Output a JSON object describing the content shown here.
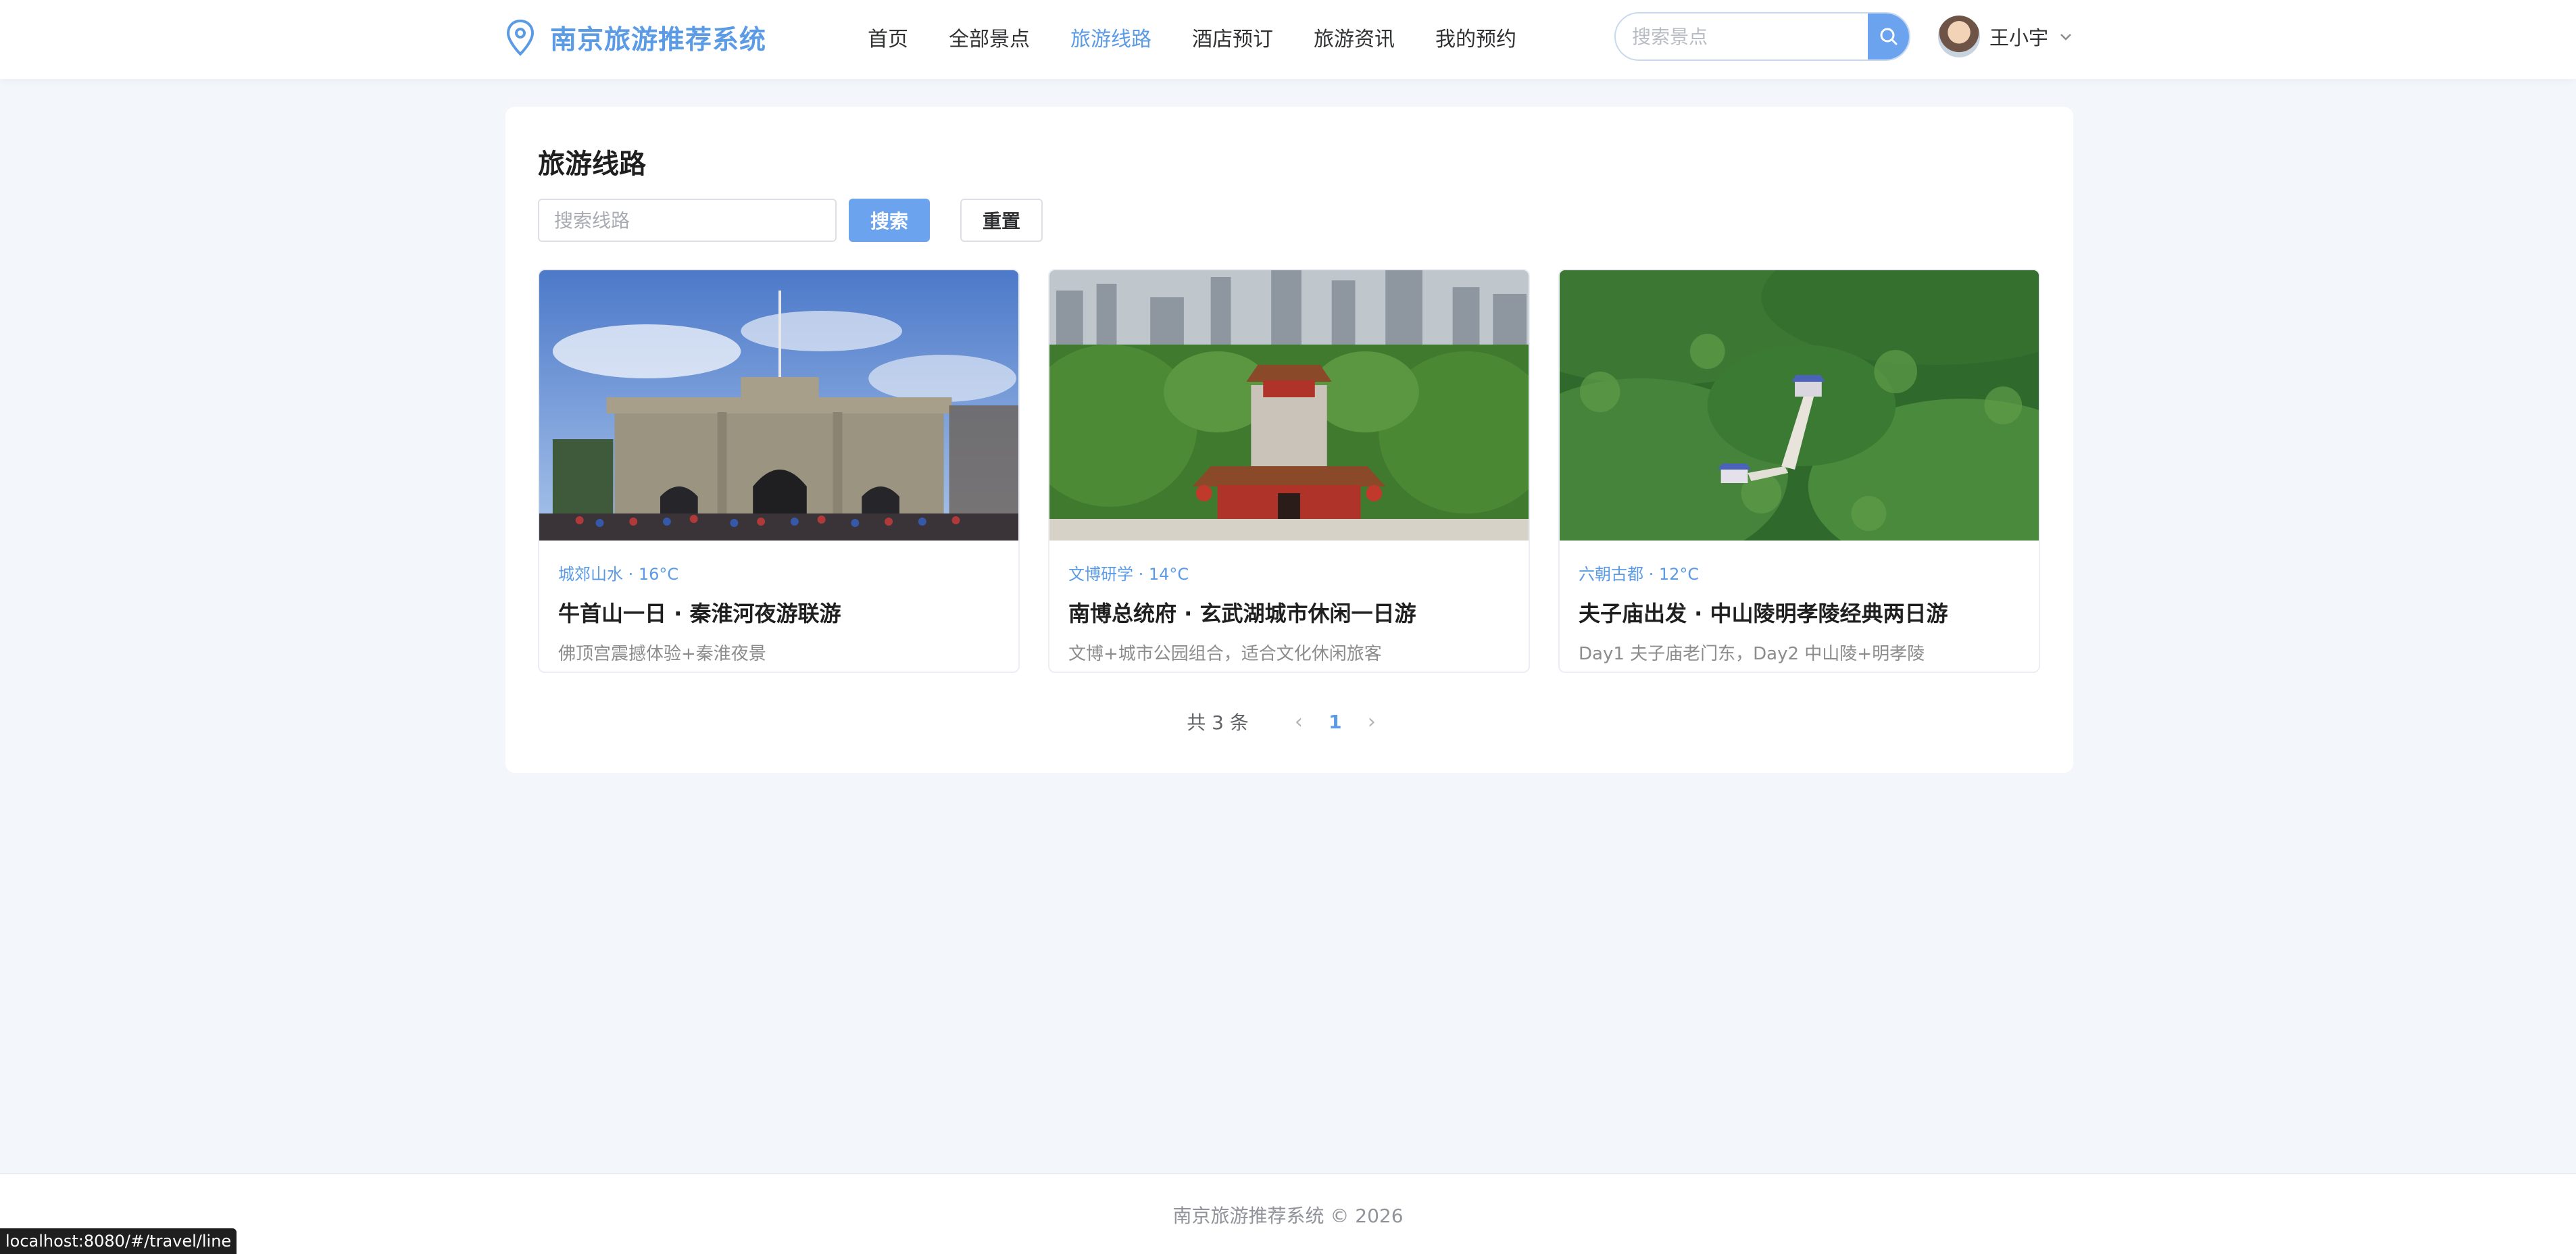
{
  "header": {
    "logo_icon": "location-pin-icon",
    "app_title": "南京旅游推荐系统",
    "nav": [
      {
        "label": "首页",
        "active": false
      },
      {
        "label": "全部景点",
        "active": false
      },
      {
        "label": "旅游线路",
        "active": true
      },
      {
        "label": "酒店预订",
        "active": false
      },
      {
        "label": "旅游资讯",
        "active": false
      },
      {
        "label": "我的预约",
        "active": false
      }
    ],
    "search": {
      "placeholder": "搜索景点",
      "value": "",
      "icon": "search-icon"
    },
    "user": {
      "name": "王小宇",
      "icon": "chevron-down-icon"
    }
  },
  "main": {
    "title": "旅游线路",
    "route_search": {
      "placeholder": "搜索线路",
      "value": ""
    },
    "search_label": "搜索",
    "reset_label": "重置",
    "cards": [
      {
        "meta": "城郊山水 · 16°C",
        "title": "牛首山一日 · 秦淮河夜游联游",
        "desc": "佛顶宫震撼体验+秦淮夜景"
      },
      {
        "meta": "文博研学 · 14°C",
        "title": "南博总统府 · 玄武湖城市休闲一日游",
        "desc": "文博+城市公园组合，适合文化休闲旅客"
      },
      {
        "meta": "六朝古都 · 12°C",
        "title": "夫子庙出发 · 中山陵明孝陵经典两日游",
        "desc": "Day1 夫子庙老门东，Day2 中山陵+明孝陵"
      }
    ],
    "pagination": {
      "total_label": "共 3 条",
      "current_page": "1",
      "prev_icon": "chevron-left-icon",
      "next_icon": "chevron-right-icon"
    }
  },
  "footer": {
    "text": "南京旅游推荐系统 © 2026"
  },
  "status_bar": {
    "url": "localhost:8080/#/travel/line"
  },
  "colors": {
    "accent": "#5b9be6",
    "button": "#6ba3ee",
    "background": "#f3f6fb"
  }
}
